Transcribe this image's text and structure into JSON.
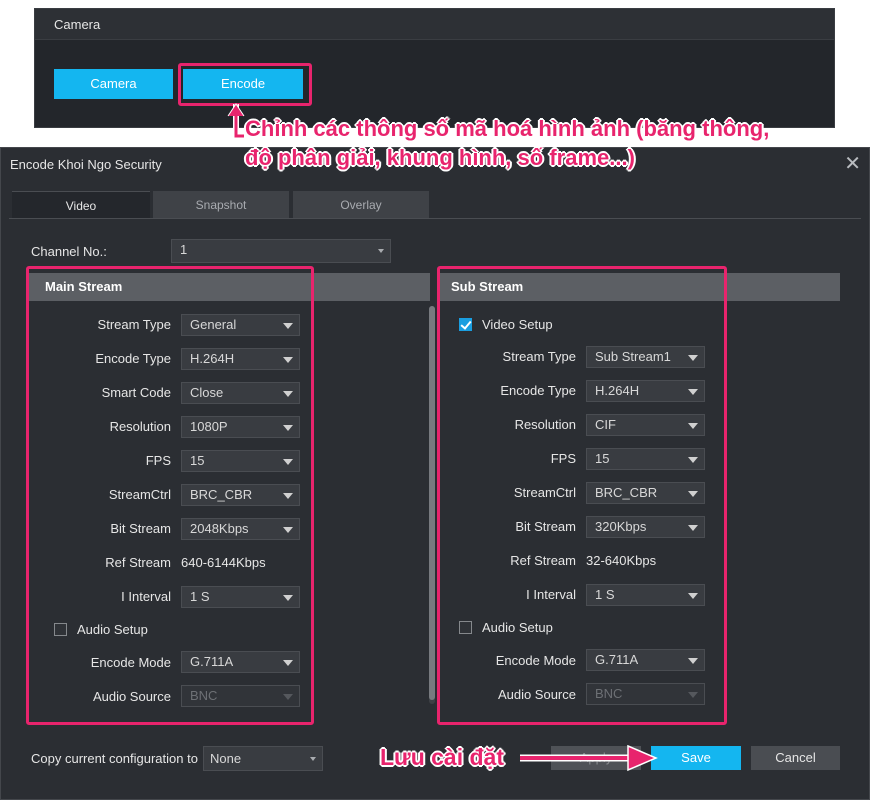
{
  "top_panel": {
    "title": "Camera",
    "camera_button": "Camera",
    "encode_button": "Encode"
  },
  "annotations": {
    "encode_note_line1": "Chỉnh các thông số mã hoá hình ảnh (băng thông,",
    "encode_note_line2": "độ phân giải, khung hình, số frame...)",
    "save_note": "Lưu cài đặt",
    "accent_color": "#e8246d"
  },
  "dialog": {
    "title": "Encode Khoi Ngo Security",
    "close_icon": "close-icon",
    "tabs": [
      {
        "label": "Video",
        "active": true
      },
      {
        "label": "Snapshot",
        "active": false
      },
      {
        "label": "Overlay",
        "active": false
      }
    ],
    "channel_label": "Channel No.:",
    "channel_value": "1"
  },
  "main_stream": {
    "header": "Main Stream",
    "stream_type_label": "Stream Type",
    "stream_type": "General",
    "encode_type_label": "Encode Type",
    "encode_type": "H.264H",
    "smart_code_label": "Smart Code",
    "smart_code": "Close",
    "resolution_label": "Resolution",
    "resolution": "1080P",
    "fps_label": "FPS",
    "fps": "15",
    "stream_ctrl_label": "StreamCtrl",
    "stream_ctrl": "BRC_CBR",
    "bit_stream_label": "Bit Stream",
    "bit_stream": "2048Kbps",
    "ref_stream_label": "Ref Stream",
    "ref_stream": "640-6144Kbps",
    "i_interval_label": "I Interval",
    "i_interval": "1 S",
    "audio_setup_label": "Audio Setup",
    "audio_setup_checked": false,
    "encode_mode_label": "Encode Mode",
    "encode_mode": "G.711A",
    "audio_source_label": "Audio Source",
    "audio_source": "BNC"
  },
  "sub_stream": {
    "header": "Sub Stream",
    "video_setup_label": "Video Setup",
    "video_setup_checked": true,
    "stream_type_label": "Stream Type",
    "stream_type": "Sub Stream1",
    "encode_type_label": "Encode Type",
    "encode_type": "H.264H",
    "resolution_label": "Resolution",
    "resolution": "CIF",
    "fps_label": "FPS",
    "fps": "15",
    "stream_ctrl_label": "StreamCtrl",
    "stream_ctrl": "BRC_CBR",
    "bit_stream_label": "Bit Stream",
    "bit_stream": "320Kbps",
    "ref_stream_label": "Ref Stream",
    "ref_stream": "32-640Kbps",
    "i_interval_label": "I Interval",
    "i_interval": "1 S",
    "audio_setup_label": "Audio Setup",
    "audio_setup_checked": false,
    "encode_mode_label": "Encode Mode",
    "encode_mode": "G.711A",
    "audio_source_label": "Audio Source",
    "audio_source": "BNC"
  },
  "footer": {
    "copy_label": "Copy current configuration to",
    "copy_value": "None",
    "apply_button": "Apply",
    "save_button": "Save",
    "cancel_button": "Cancel"
  },
  "colors": {
    "accent_cyan": "#14b6f0",
    "panel_bg": "#2b2e33",
    "stream_header_bg": "#5c5f64"
  }
}
